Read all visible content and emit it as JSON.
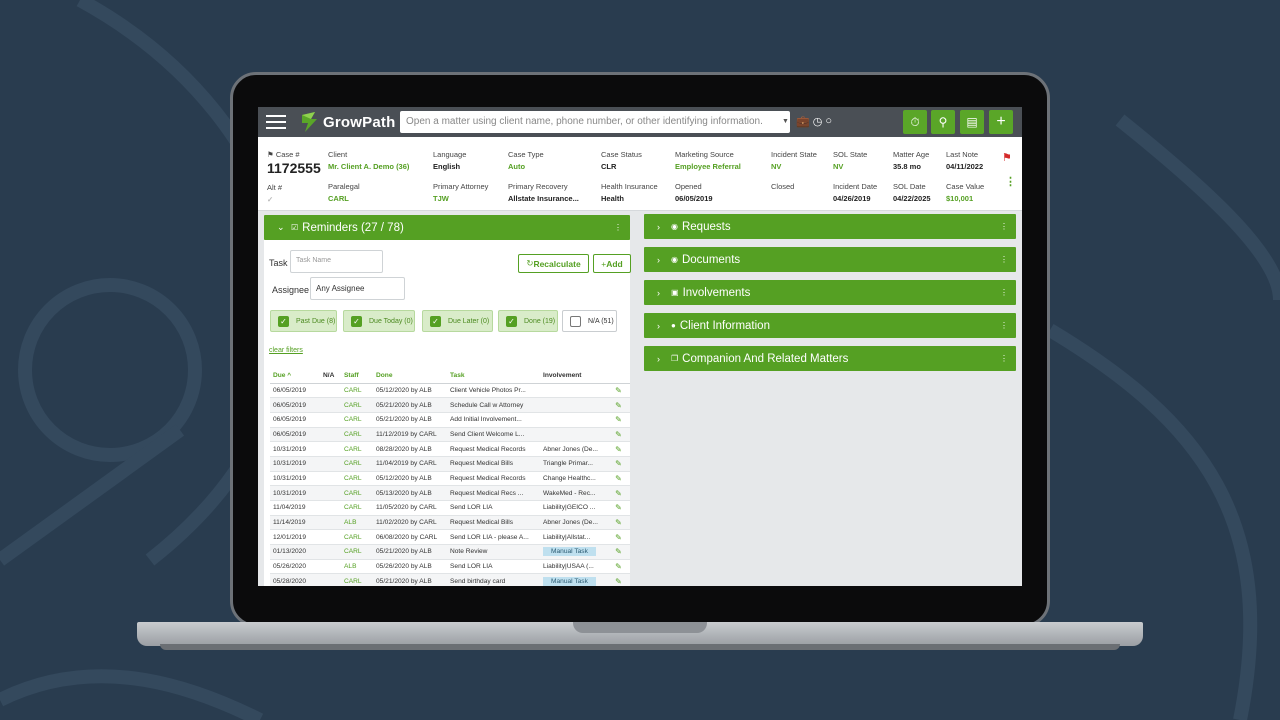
{
  "app": {
    "name": "GrowPath",
    "search_placeholder": "Open a matter using client name, phone number, or other identifying information."
  },
  "case": {
    "case_label": "Case #",
    "case_number": "1172555",
    "alt_label": "Alt #",
    "fields_row1": [
      {
        "label": "Client",
        "value": "Mr. Client A. Demo (36)",
        "green": true
      },
      {
        "label": "Language",
        "value": "English",
        "green": false
      },
      {
        "label": "Case Type",
        "value": "Auto",
        "green": true
      },
      {
        "label": "Case Status",
        "value": "CLR",
        "green": false
      },
      {
        "label": "Marketing Source",
        "value": "Employee Referral",
        "green": true
      },
      {
        "label": "Incident State",
        "value": "NV",
        "green": true
      },
      {
        "label": "SOL State",
        "value": "NV",
        "green": true
      },
      {
        "label": "Matter Age",
        "value": "35.8 mo",
        "green": false
      },
      {
        "label": "Last Note",
        "value": "04/11/2022",
        "green": false
      }
    ],
    "fields_row2": [
      {
        "label": "Paralegal",
        "value": "CARL",
        "green": true
      },
      {
        "label": "Primary Attorney",
        "value": "TJW",
        "green": true
      },
      {
        "label": "Primary Recovery",
        "value": "Allstate Insurance...",
        "green": false
      },
      {
        "label": "Health Insurance",
        "value": "Health",
        "green": false
      },
      {
        "label": "Opened",
        "value": "06/05/2019",
        "green": false
      },
      {
        "label": "Closed",
        "value": "",
        "green": false
      },
      {
        "label": "Incident Date",
        "value": "04/26/2019",
        "green": false
      },
      {
        "label": "SOL Date",
        "value": "04/22/2025",
        "green": false
      },
      {
        "label": "Case Value",
        "value": "$10,001",
        "green": true
      }
    ]
  },
  "reminders": {
    "title": "Reminders (27 / 78)",
    "task_label": "Task",
    "task_placeholder": "Task Name",
    "assignee_label": "Assignee",
    "assignee_value": "Any Assignee",
    "recalculate_label": "Recalculate",
    "add_label": "Add",
    "filters": [
      {
        "label": "Past Due (8)",
        "checked": true
      },
      {
        "label": "Due Today (0)",
        "checked": true
      },
      {
        "label": "Due Later (0)",
        "checked": true
      },
      {
        "label": "Done (19)",
        "checked": true
      },
      {
        "label": "N/A (51)",
        "checked": false
      }
    ],
    "clear_filters": "clear filters",
    "columns": [
      "Due ^",
      "N/A",
      "Staff",
      "Done",
      "Task",
      "Involvement"
    ],
    "rows": [
      {
        "due": "06/05/2019",
        "staff": "CARL",
        "done": "05/12/2020 by ALB",
        "task": "Client Vehicle Photos Pr...",
        "involvement": "",
        "manual": false
      },
      {
        "due": "06/05/2019",
        "staff": "CARL",
        "done": "05/21/2020 by ALB",
        "task": "Schedule Call w Attorney",
        "involvement": "",
        "manual": false
      },
      {
        "due": "06/05/2019",
        "staff": "CARL",
        "done": "05/21/2020 by ALB",
        "task": "Add Initial Involvement...",
        "involvement": "",
        "manual": false
      },
      {
        "due": "06/05/2019",
        "staff": "CARL",
        "done": "11/12/2019 by CARL",
        "task": "Send Client Welcome L...",
        "involvement": "",
        "manual": false
      },
      {
        "due": "10/31/2019",
        "staff": "CARL",
        "done": "08/28/2020 by ALB",
        "task": "Request Medical Records",
        "involvement": "Abner Jones (De...",
        "manual": false
      },
      {
        "due": "10/31/2019",
        "staff": "CARL",
        "done": "11/04/2019 by CARL",
        "task": "Request Medical Bills",
        "involvement": "Triangle Primar...",
        "manual": false
      },
      {
        "due": "10/31/2019",
        "staff": "CARL",
        "done": "05/12/2020 by ALB",
        "task": "Request Medical Records",
        "involvement": "Change Healthc...",
        "manual": false
      },
      {
        "due": "10/31/2019",
        "staff": "CARL",
        "done": "05/13/2020 by ALB",
        "task": "Request Medical Recs ...",
        "involvement": "WakeMed - Rec...",
        "manual": false
      },
      {
        "due": "11/04/2019",
        "staff": "CARL",
        "done": "11/05/2020 by CARL",
        "task": "Send LOR LIA",
        "involvement": "Liability|GEICO ...",
        "manual": false
      },
      {
        "due": "11/14/2019",
        "staff": "ALB",
        "done": "11/02/2020 by CARL",
        "task": "Request Medical Bills",
        "involvement": "Abner Jones (De...",
        "manual": false
      },
      {
        "due": "12/01/2019",
        "staff": "CARL",
        "done": "06/08/2020 by CARL",
        "task": "Send LOR LIA - please A...",
        "involvement": "Liability|Allstat...",
        "manual": false
      },
      {
        "due": "01/13/2020",
        "staff": "CARL",
        "done": "05/21/2020 by ALB",
        "task": "Note Review",
        "involvement": "Manual Task",
        "manual": true
      },
      {
        "due": "05/26/2020",
        "staff": "ALB",
        "done": "05/26/2020 by ALB",
        "task": "Send LOR LIA",
        "involvement": "Liability|USAA (...",
        "manual": false
      },
      {
        "due": "05/28/2020",
        "staff": "CARL",
        "done": "05/21/2020 by ALB",
        "task": "Send birthday card",
        "involvement": "Manual Task",
        "manual": true
      }
    ]
  },
  "side_panels": [
    {
      "title": "Requests",
      "icon": "eye-icon"
    },
    {
      "title": "Documents",
      "icon": "eye-icon"
    },
    {
      "title": "Involvements",
      "icon": "id-badge-icon"
    },
    {
      "title": "Client Information",
      "icon": "user-circle-icon"
    },
    {
      "title": "Companion And Related Matters",
      "icon": "copy-icon"
    }
  ],
  "colors": {
    "accent": "#55a023",
    "topbar": "#4a4f55",
    "background": "#293c4f",
    "flag": "#d42a2a"
  }
}
